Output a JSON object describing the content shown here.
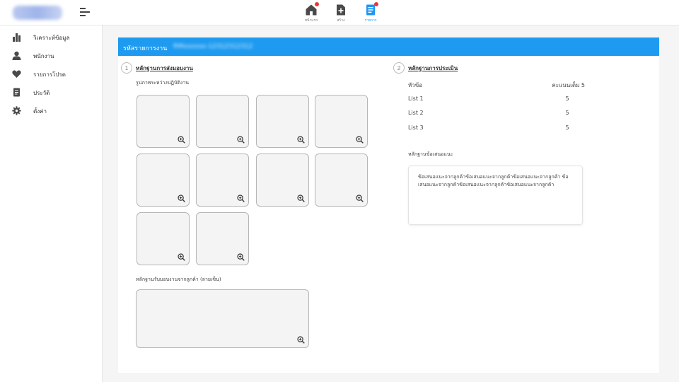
{
  "header": {
    "nav": [
      {
        "label": "หน้าแรก",
        "icon": "home-icon",
        "badge": true,
        "active": false
      },
      {
        "label": "สร้าง",
        "icon": "add-document-icon",
        "badge": false,
        "active": false
      },
      {
        "label": "รายการ",
        "icon": "document-list-icon",
        "badge": true,
        "active": true
      }
    ]
  },
  "sidebar": {
    "items": [
      {
        "label": "วิเคราะห์ข้อมูล",
        "icon": "bar-chart-icon"
      },
      {
        "label": "พนักงาน",
        "icon": "user-icon"
      },
      {
        "label": "รายการโปรด",
        "icon": "heart-icon"
      },
      {
        "label": "ประวัติ",
        "icon": "document-icon"
      },
      {
        "label": "ตั้งค่า",
        "icon": "gear-icon"
      }
    ]
  },
  "card": {
    "title": "รหัสรายการงาน",
    "code": "RMxxxxxx-12312312312"
  },
  "delivery": {
    "step_number": "1",
    "title": "หลักฐานการส่งมอบงาน",
    "photos_label": "รูปภาพระหว่างปฏิบัติงาน",
    "photo_count": 10,
    "signature_label": "หลักฐานรับมอบงานจากลูกค้า (ลายเซ็น)"
  },
  "evaluation": {
    "step_number": "2",
    "title": "หลักฐานการประเมิน",
    "col_topic": "หัวข้อ",
    "col_score": "คะแนนเต็ม 5",
    "rows": [
      {
        "topic": "List 1",
        "score": "5"
      },
      {
        "topic": "List 2",
        "score": "5"
      },
      {
        "topic": "List 3",
        "score": "5"
      }
    ],
    "suggestion_label": "หลักฐานข้อเสนอแนะ",
    "suggestion_text": "ข้อเสนอแนะจากลูกค้าข้อเสนอแนะจากลูกค้าข้อเสนอแนะจากลูกค้า ข้อเสนอแนะจากลูกค้าข้อเสนอแนะจากลูกค้าข้อเสนอแนะจากลูกค้า"
  },
  "colors": {
    "accent": "#1e9bf0",
    "badge": "#e53935",
    "icon": "#4a4a4a"
  }
}
